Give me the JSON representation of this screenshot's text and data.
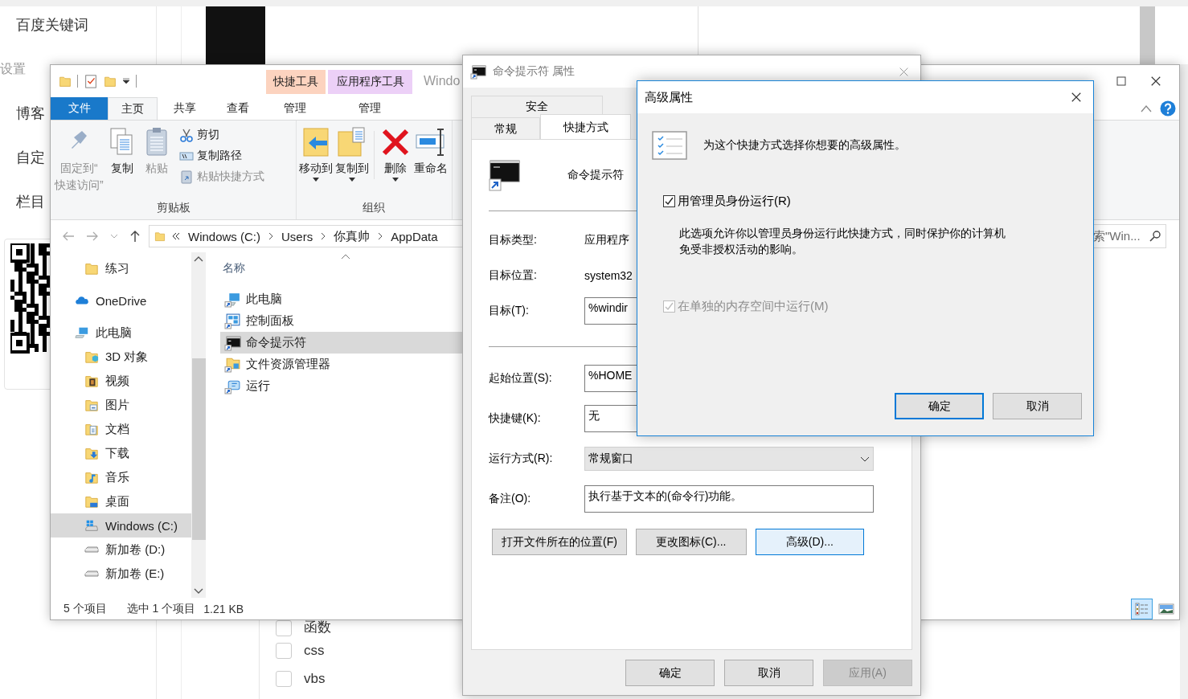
{
  "background_page": {
    "sidebar_items": [
      "百度关键词",
      "设置",
      "博客",
      "自定",
      "栏目"
    ],
    "checklist": [
      {
        "label": "函数",
        "checked": false
      },
      {
        "label": "css",
        "checked": false
      },
      {
        "label": "vbs",
        "checked": false
      }
    ]
  },
  "explorer": {
    "title": "Windo",
    "contextual_tabs": [
      {
        "label": "快捷工具",
        "color": "#fcd3bf"
      },
      {
        "label": "应用程序工具",
        "color": "#ecd0f7"
      }
    ],
    "ribbon_tabs": [
      {
        "label": "文件",
        "kind": "file",
        "selected": false
      },
      {
        "label": "主页",
        "kind": "tab",
        "selected": true
      },
      {
        "label": "共享",
        "kind": "tab",
        "selected": false
      },
      {
        "label": "查看",
        "kind": "tab",
        "selected": false
      },
      {
        "label": "管理",
        "kind": "context",
        "selected": false
      },
      {
        "label": "管理",
        "kind": "context",
        "selected": false
      }
    ],
    "ribbon_groups": [
      {
        "label": "剪贴板",
        "commands": [
          {
            "kind": "large",
            "lines": [
              "固定到“",
              "快速访问”"
            ],
            "disabled": true
          },
          {
            "kind": "large",
            "lines": [
              "复制"
            ],
            "disabled": false
          },
          {
            "kind": "large",
            "lines": [
              "粘贴"
            ],
            "disabled": true
          },
          {
            "kind": "small",
            "lines": [
              "剪切"
            ],
            "disabled": false
          },
          {
            "kind": "small",
            "lines": [
              "复制路径"
            ],
            "disabled": false
          },
          {
            "kind": "small",
            "lines": [
              "粘贴快捷方式"
            ],
            "disabled": true
          }
        ]
      },
      {
        "label": "组织",
        "commands": [
          {
            "kind": "large",
            "lines": [
              "移动到"
            ],
            "disabled": false
          },
          {
            "kind": "large",
            "lines": [
              "复制到"
            ],
            "disabled": false
          },
          {
            "kind": "large",
            "lines": [
              "删除"
            ],
            "disabled": false
          },
          {
            "kind": "large",
            "lines": [
              "重命名"
            ],
            "disabled": false
          }
        ]
      }
    ],
    "breadcrumbs": [
      "Windows (C:)",
      "Users",
      "你真帅",
      "AppData"
    ],
    "search": {
      "placeholder": "索\"Win..."
    },
    "nav_tree": [
      {
        "children": [
          {
            "label": "练习",
            "selected": false
          }
        ]
      },
      {
        "label": "OneDrive",
        "selected": false
      },
      {
        "label": "此电脑",
        "selected": false,
        "children": [
          {
            "label": "3D 对象",
            "selected": false
          },
          {
            "label": "视频",
            "selected": false
          },
          {
            "label": "图片",
            "selected": false
          },
          {
            "label": "文档",
            "selected": false
          },
          {
            "label": "下载",
            "selected": false
          },
          {
            "label": "音乐",
            "selected": false
          },
          {
            "label": "桌面",
            "selected": false
          },
          {
            "label": "Windows (C:)",
            "selected": true
          },
          {
            "label": "新加卷 (D:)",
            "selected": false
          },
          {
            "label": "新加卷 (E:)",
            "selected": false
          }
        ]
      }
    ],
    "column_header": "名称",
    "files": [
      {
        "name": "此电脑",
        "selected": false
      },
      {
        "name": "控制面板",
        "selected": false
      },
      {
        "name": "命令提示符",
        "selected": true
      },
      {
        "name": "文件资源管理器",
        "selected": false
      },
      {
        "name": "运行",
        "selected": false
      }
    ],
    "status_bar": {
      "item_count": "5 个项目",
      "selection": "选中 1 个项目",
      "size": "1.21 KB"
    },
    "view_buttons": [
      {
        "kind": "details",
        "selected": true
      },
      {
        "kind": "large-icons",
        "selected": false
      }
    ]
  },
  "properties_dialog": {
    "title": "命令提示符 属性",
    "tabs": [
      {
        "label": "安全",
        "selected": false
      },
      {
        "label": "常规",
        "selected": false
      },
      {
        "label": "快捷方式",
        "selected": true
      }
    ],
    "program_name": "命令提示符",
    "field_groups": [
      [
        {
          "label": "目标类型:",
          "kind": "text",
          "value": "应用程序"
        },
        {
          "label": "目标位置:",
          "kind": "text",
          "value": "system32"
        },
        {
          "label": "目标(T):",
          "kind": "input",
          "value": "%windir"
        }
      ],
      [
        {
          "label": "起始位置(S):",
          "kind": "input",
          "value": "%HOME"
        },
        {
          "label": "快捷键(K):",
          "kind": "input",
          "value": "无"
        },
        {
          "label": "运行方式(R):",
          "kind": "dropdown",
          "value": "常规窗口"
        },
        {
          "label": "备注(O):",
          "kind": "input",
          "value": "执行基于文本的(命令行)功能。"
        }
      ]
    ],
    "action_buttons": [
      {
        "label": "打开文件所在的位置(F)",
        "focused": false
      },
      {
        "label": "更改图标(C)...",
        "focused": false
      },
      {
        "label": "高级(D)...",
        "focused": true
      }
    ],
    "footer_buttons": [
      {
        "label": "确定",
        "disabled": false
      },
      {
        "label": "取消",
        "disabled": false
      },
      {
        "label": "应用(A)",
        "disabled": true
      }
    ]
  },
  "advanced_dialog": {
    "title": "高级属性",
    "intro": "为这个快捷方式选择你想要的高级属性。",
    "options": [
      {
        "label": "用管理员身份运行(R)",
        "checked": true,
        "disabled": false,
        "description": "此选项允许你以管理员身份运行此快捷方式，同时保护你的计算机免受非授权活动的影响。"
      },
      {
        "label": "在单独的内存空间中运行(M)",
        "checked": true,
        "disabled": true
      }
    ],
    "buttons": [
      {
        "label": "确定",
        "default": true
      },
      {
        "label": "取消",
        "default": false
      }
    ]
  }
}
